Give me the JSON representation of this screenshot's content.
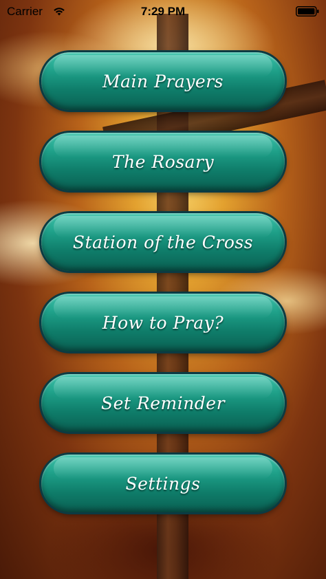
{
  "status_bar": {
    "carrier": "Carrier",
    "time": "7:29 PM",
    "wifi_icon": "wifi-icon",
    "battery_icon": "battery-icon"
  },
  "menu": {
    "items": [
      {
        "label": "Main Prayers"
      },
      {
        "label": "The Rosary"
      },
      {
        "label": "Station of the Cross"
      },
      {
        "label": "How to Pray?"
      },
      {
        "label": "Set Reminder"
      },
      {
        "label": "Settings"
      }
    ]
  },
  "colors": {
    "button_accent": "#1d9d86",
    "button_border": "#0b3b43",
    "background_warm": "#e3a12f"
  }
}
